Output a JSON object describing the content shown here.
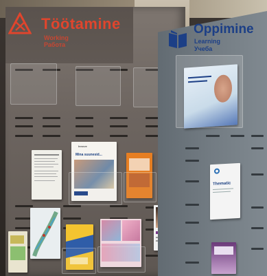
{
  "signs": {
    "left": {
      "title": "Töötamine",
      "subtitle_1": "Working",
      "subtitle_2": "Работа",
      "color": "#e0452d",
      "icon": "warning-triangle-icon"
    },
    "right": {
      "title": "Oppimine",
      "subtitle_1": "Learning",
      "subtitle_2": "Учеба",
      "color": "#1c3f86",
      "icon": "open-book-icon"
    }
  },
  "brochures": {
    "mina_text": "Mina suunesid...",
    "brand": "Innove",
    "thematic_label": "Thematic"
  }
}
